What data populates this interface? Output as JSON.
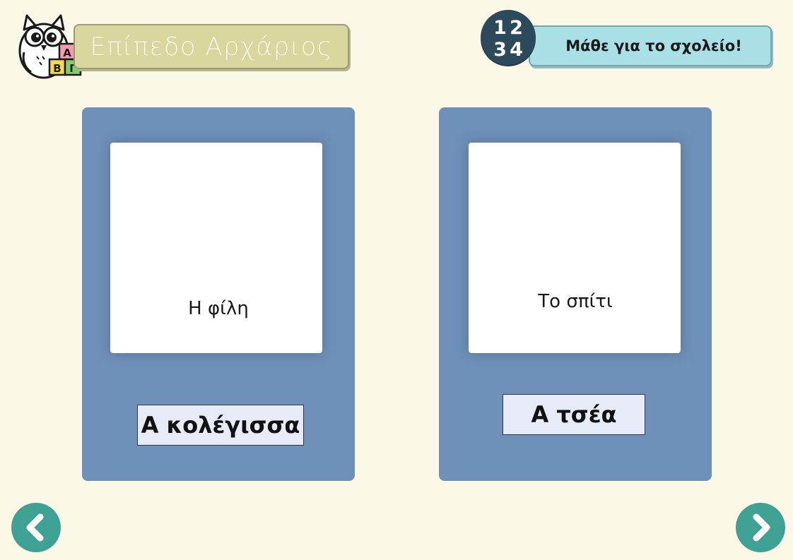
{
  "header": {
    "level_title": "Επίπεδο Αρχάριος",
    "badge_numbers": [
      "1",
      "2",
      "3",
      "4"
    ],
    "learn_title": "Μάθε για το σχολείο!"
  },
  "logo": {
    "icon": "owl-with-letter-blocks-icon",
    "blocks": [
      "A",
      "B",
      "Γ"
    ]
  },
  "cards": [
    {
      "caption": "Η φίλη",
      "word": "Α κολέγισσα"
    },
    {
      "caption": "Το σπίτι",
      "word": "Α τσέα"
    }
  ],
  "nav": {
    "prev_icon": "chevron-left-icon",
    "next_icon": "chevron-right-icon"
  },
  "colors": {
    "background": "#fcf8e8",
    "level_banner": "#d9d69e",
    "learn_banner": "#a9e0e6",
    "badge": "#2c4a5b",
    "card": "#6f90b8",
    "word_box": "#e6ebf7",
    "nav_button": "#3fa193"
  }
}
